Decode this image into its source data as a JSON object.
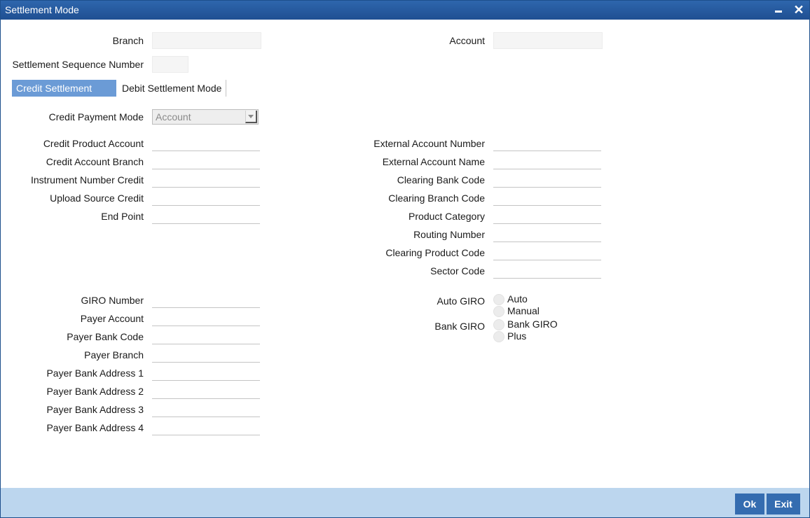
{
  "window": {
    "title": "Settlement Mode"
  },
  "header": {
    "branch_label": "Branch",
    "branch_value": "",
    "account_label": "Account",
    "account_value": "",
    "seq_label": "Settlement Sequence Number",
    "seq_value": ""
  },
  "tabs": [
    {
      "label": "Credit Settlement Mode",
      "active": true
    },
    {
      "label": "Debit Settlement Mode",
      "active": false
    }
  ],
  "credit": {
    "payment_mode_label": "Credit Payment Mode",
    "payment_mode_value": "Account",
    "left_fields": [
      {
        "label": "Credit Product Account",
        "value": ""
      },
      {
        "label": "Credit Account Branch",
        "value": ""
      },
      {
        "label": "Instrument Number Credit",
        "value": ""
      },
      {
        "label": "Upload Source Credit",
        "value": ""
      },
      {
        "label": "End Point",
        "value": ""
      }
    ],
    "right_fields": [
      {
        "label": "External Account Number",
        "value": ""
      },
      {
        "label": "External Account Name",
        "value": ""
      },
      {
        "label": "Clearing Bank Code",
        "value": ""
      },
      {
        "label": "Clearing Branch Code",
        "value": ""
      },
      {
        "label": "Product Category",
        "value": ""
      },
      {
        "label": "Routing Number",
        "value": ""
      },
      {
        "label": "Clearing Product Code",
        "value": ""
      },
      {
        "label": "Sector Code",
        "value": ""
      }
    ],
    "giro_fields": [
      {
        "label": "GIRO Number",
        "value": ""
      },
      {
        "label": "Payer Account",
        "value": ""
      },
      {
        "label": "Payer Bank Code",
        "value": ""
      },
      {
        "label": "Payer Branch",
        "value": ""
      },
      {
        "label": "Payer Bank Address 1",
        "value": ""
      },
      {
        "label": "Payer Bank Address 2",
        "value": ""
      },
      {
        "label": "Payer Bank Address 3",
        "value": ""
      },
      {
        "label": "Payer Bank Address 4",
        "value": ""
      }
    ],
    "auto_giro": {
      "label": "Auto GIRO",
      "options": [
        "Auto",
        "Manual"
      ],
      "selected": null
    },
    "bank_giro": {
      "label": "Bank GIRO",
      "options": [
        "Bank GIRO",
        "Plus"
      ],
      "selected": null
    }
  },
  "footer": {
    "ok_label": "Ok",
    "exit_label": "Exit"
  },
  "colors": {
    "titlebar": "#2e66ad",
    "active_tab": "#6b9bd6",
    "footer": "#bcd6ee",
    "button": "#346cb0"
  }
}
